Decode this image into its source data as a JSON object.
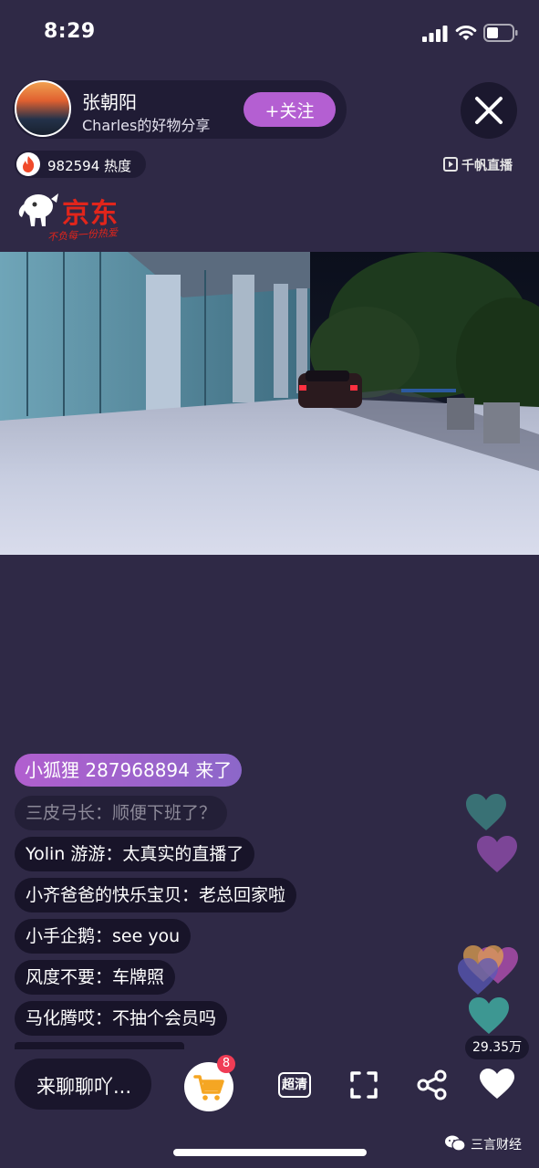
{
  "status_bar": {
    "time": "8:29"
  },
  "streamer": {
    "name": "张朝阳",
    "subtitle": "Charles的好物分享",
    "follow_label": "+关注"
  },
  "heat": {
    "value": "982594 热度"
  },
  "platform": {
    "name": "千帆直播"
  },
  "brand": {
    "name": "京东",
    "slogan": "不负每一份热爱"
  },
  "chat": {
    "entry": "小狐狸 287968894 来了",
    "messages": [
      {
        "text": "三皮弓长：顺便下班了？"
      },
      {
        "text": "Yolin 游游：太真实的直播了"
      },
      {
        "text": "小齐爸爸的快乐宝贝：老总回家啦"
      },
      {
        "text": "小手企鹅：see you"
      },
      {
        "text": "风度不要：车牌照"
      },
      {
        "text": "马化腾哎：不抽个会员吗"
      }
    ]
  },
  "likes": {
    "count": "29.35万"
  },
  "bottom_bar": {
    "chat_placeholder": "来聊聊吖...",
    "cart_count": "8",
    "quality_label": "超清"
  },
  "watermark": {
    "text": "三言财经"
  },
  "colors": {
    "background": "#2f2946",
    "accent": "#b45fd2",
    "brand_red": "#e1251b",
    "badge": "#f03c55"
  }
}
